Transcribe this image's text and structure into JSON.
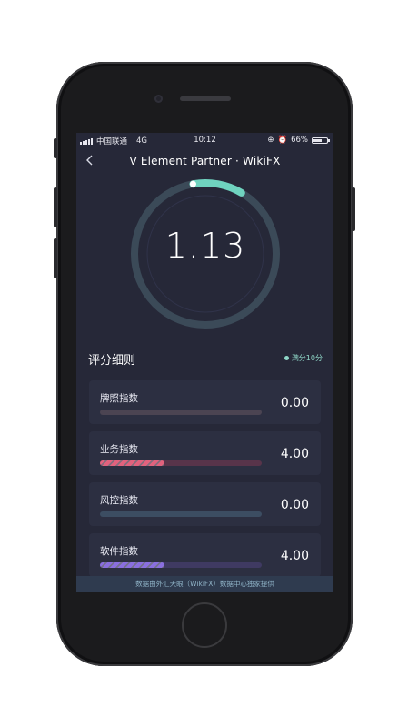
{
  "status_bar": {
    "carrier": "中国联通",
    "network": "4G",
    "time": "10:12",
    "battery": "66%",
    "battery_level": 0.66
  },
  "header": {
    "title": "V Element Partner · WikiFX"
  },
  "score": {
    "value": "1.13",
    "max": 10,
    "gauge_fraction": 0.113,
    "accent_color": "#6fd3bf"
  },
  "breakdown": {
    "title": "评分细则",
    "legend": "满分10分",
    "items": [
      {
        "label": "牌照指数",
        "value": "0.00",
        "fraction": 0.0,
        "fill_color": "#e2627d",
        "track_color": "#4b4452"
      },
      {
        "label": "业务指数",
        "value": "4.00",
        "fraction": 0.4,
        "fill_color": "#e2627d",
        "track_color": "#58344a"
      },
      {
        "label": "风控指数",
        "value": "0.00",
        "fraction": 0.0,
        "fill_color": "#5aa0c0",
        "track_color": "#3c4d62"
      },
      {
        "label": "软件指数",
        "value": "4.00",
        "fraction": 0.4,
        "fill_color": "#8a6fe0",
        "track_color": "#3f3a62"
      }
    ]
  },
  "footer": {
    "text": "数据由外汇天眼（WikiFX）数据中心独家提供"
  }
}
